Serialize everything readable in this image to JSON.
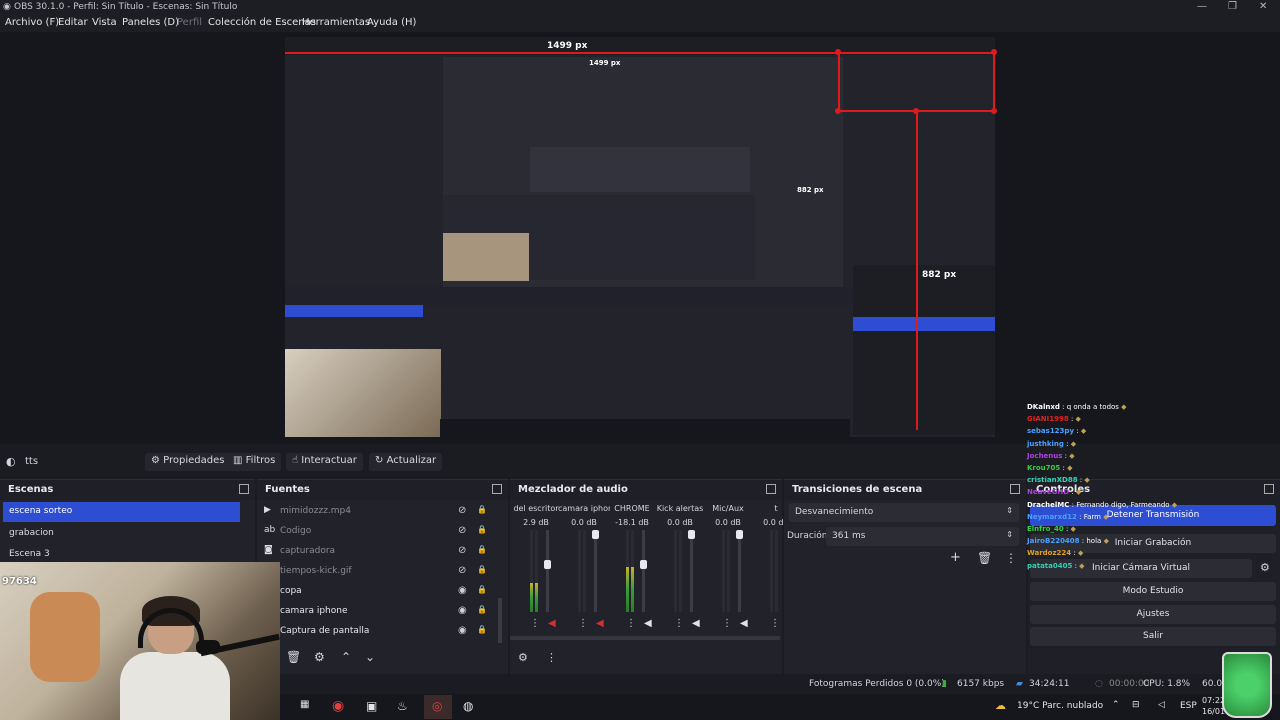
{
  "window": {
    "title": "OBS 30.1.0 - Perfil: Sin Título - Escenas: Sin Título",
    "min": "—",
    "max": "❐",
    "close": "✕"
  },
  "menu": {
    "items": [
      "Archivo (F)",
      "Editar",
      "Vista",
      "Paneles (D)",
      "Perfil",
      "Colección de Escenas",
      "Herramientas",
      "Ayuda (H)"
    ]
  },
  "preview": {
    "top_label": "1499 px",
    "mid_label": "882 px",
    "nested_label": "1499 px",
    "nested_label2": "882 px"
  },
  "source_toolbar": {
    "source_name": "tts",
    "properties": "Propiedades",
    "filters": "Filtros",
    "interact": "Interactuar",
    "refresh": "Actualizar"
  },
  "scenes": {
    "title": "Escenas",
    "items": [
      {
        "label": "escena sorteo",
        "selected": true
      },
      {
        "label": "grabacion",
        "selected": false
      },
      {
        "label": "Escena 3",
        "selected": false
      }
    ]
  },
  "sources": {
    "title": "Fuentes",
    "items": [
      {
        "label": "mimidozzz.mp4",
        "icon": "play-icon",
        "visible": false
      },
      {
        "label": "Codigo",
        "icon": "text-icon",
        "visible": false
      },
      {
        "label": "capturadora",
        "icon": "camera-icon",
        "visible": false
      },
      {
        "label": "tiempos-kick.gif",
        "icon": "image-icon",
        "visible": false
      },
      {
        "label": "copa",
        "icon": "image-icon",
        "visible": true
      },
      {
        "label": "camara iphone",
        "icon": "camera-icon",
        "visible": true
      },
      {
        "label": "Captura de pantalla",
        "icon": "monitor-icon",
        "visible": true
      }
    ]
  },
  "mixer": {
    "title": "Mezclador de audio",
    "channels": [
      {
        "name": "del escritor",
        "db": "2.9 dB",
        "level": 0.35
      },
      {
        "name": "camara iphone",
        "db": "0.0 dB",
        "level": 0.0
      },
      {
        "name": "CHROME",
        "db": "-18.1 dB",
        "level": 0.55
      },
      {
        "name": "Kick alertas",
        "db": "0.0 dB",
        "level": 0.0
      },
      {
        "name": "Mic/Aux",
        "db": "0.0 dB",
        "level": 0.0
      },
      {
        "name": "t",
        "db": "0.0 dB",
        "level": 0.0
      }
    ],
    "scale": [
      "0",
      "-5",
      "-10",
      "-15",
      "-20",
      "-25",
      "-30",
      "-35",
      "-40",
      "-45",
      "-50",
      "-55",
      "-60"
    ]
  },
  "transitions": {
    "title": "Transiciones de escena",
    "selected": "Desvanecimiento",
    "duration_label": "Duración",
    "duration_value": "361 ms"
  },
  "controls": {
    "title": "Controles",
    "stop_stream": "Detener Transmisión",
    "start_recording": "Iniciar Grabación",
    "start_virtual_cam": "Iniciar Cámara Virtual",
    "studio_mode": "Modo Estudio",
    "settings": "Ajustes",
    "exit": "Salir"
  },
  "chat": [
    {
      "user": "DKalnxd",
      "msg": "q onda a todos",
      "color": "#ffffff"
    },
    {
      "user": "GIANI1998",
      "msg": "",
      "color": "#e02020"
    },
    {
      "user": "sebas123py",
      "msg": "",
      "color": "#4aa0ff"
    },
    {
      "user": "justhking",
      "msg": "",
      "color": "#4aa0ff"
    },
    {
      "user": "Jochenus",
      "msg": "",
      "color": "#b040e0"
    },
    {
      "user": "Krou705",
      "msg": "",
      "color": "#30d040"
    },
    {
      "user": "cristianXD88",
      "msg": "",
      "color": "#30d0b0"
    },
    {
      "user": "NeaveGHD",
      "msg": "",
      "color": "#b040e0"
    },
    {
      "user": "DrachelMC",
      "msg": "Fernando digo, Farmeando",
      "color": "#ffffff"
    },
    {
      "user": "Neymarxd12",
      "msg": "Farm",
      "color": "#4aa0ff"
    },
    {
      "user": "Elnfro_40",
      "msg": "",
      "color": "#30d040"
    },
    {
      "user": "JairoB220408",
      "msg": "hola",
      "color": "#4aa0ff"
    },
    {
      "user": "Wardoz224",
      "msg": "",
      "color": "#e0a020"
    },
    {
      "user": "patata0405",
      "msg": "",
      "color": "#30d0b0"
    }
  ],
  "status": {
    "dropped": "Fotogramas Perdidos 0 (0.0%)",
    "bitrate": "6157 kbps",
    "stream_time": "34:24:11",
    "rec_time": "00:00:00",
    "cpu": "CPU: 1.8%",
    "fps": "60.00"
  },
  "taskbar": {
    "weather": "19°C  Parc. nublado",
    "lang": "ESP",
    "time": "07:22",
    "date": "16/01"
  },
  "webcam": {
    "counter": "97634"
  }
}
